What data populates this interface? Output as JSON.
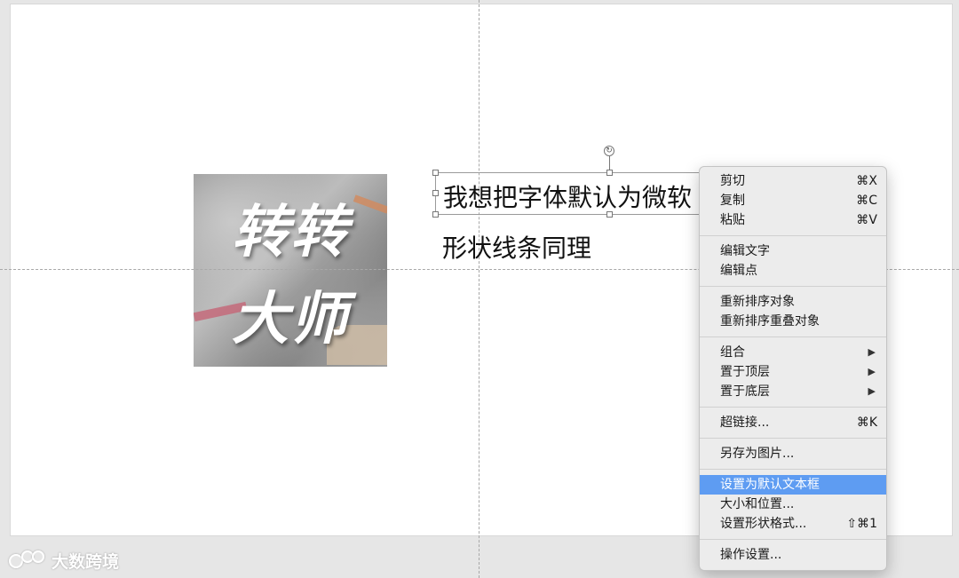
{
  "slide": {
    "logo_line1": "转转",
    "logo_line2": "大师",
    "textbox_text": "我想把字体默认为微软",
    "second_text": "形状线条同理"
  },
  "context_menu": {
    "groups": [
      [
        {
          "label": "剪切",
          "shortcut": "⌘X"
        },
        {
          "label": "复制",
          "shortcut": "⌘C"
        },
        {
          "label": "粘贴",
          "shortcut": "⌘V"
        }
      ],
      [
        {
          "label": "编辑文字"
        },
        {
          "label": "编辑点"
        }
      ],
      [
        {
          "label": "重新排序对象"
        },
        {
          "label": "重新排序重叠对象"
        }
      ],
      [
        {
          "label": "组合",
          "submenu": true
        },
        {
          "label": "置于顶层",
          "submenu": true
        },
        {
          "label": "置于底层",
          "submenu": true
        }
      ],
      [
        {
          "label": "超链接...",
          "shortcut": "⌘K"
        }
      ],
      [
        {
          "label": "另存为图片..."
        }
      ],
      [
        {
          "label": "设置为默认文本框",
          "highlighted": true
        },
        {
          "label": "大小和位置..."
        },
        {
          "label": "设置形状格式...",
          "shortcut": "⇧⌘1"
        }
      ],
      [
        {
          "label": "操作设置..."
        }
      ]
    ],
    "submenu_arrow": "▶",
    "highlight_color": "#5e9cf2"
  },
  "watermark": {
    "text": "大数跨境"
  }
}
